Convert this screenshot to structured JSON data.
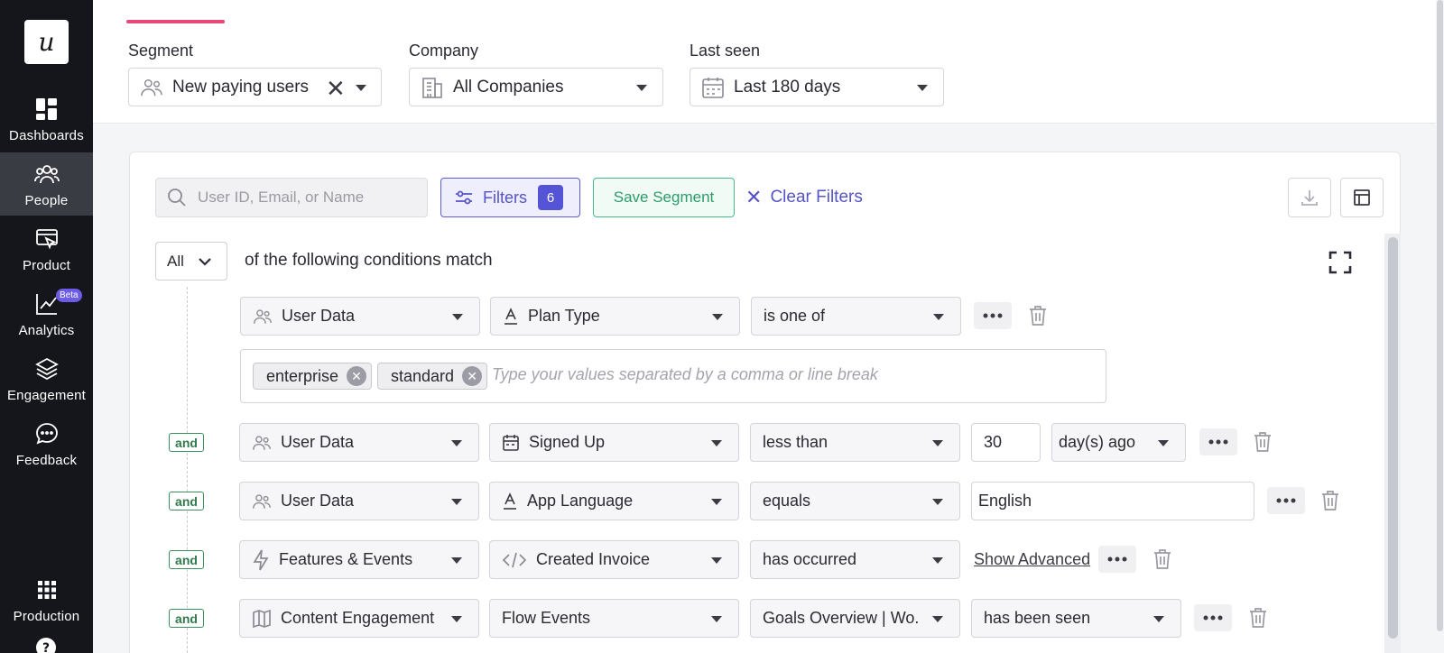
{
  "sidebar": {
    "logo": "u",
    "items": [
      {
        "label": "Dashboards",
        "icon": "dashboard-icon"
      },
      {
        "label": "People",
        "icon": "people-icon"
      },
      {
        "label": "Product",
        "icon": "product-icon"
      },
      {
        "label": "Analytics",
        "icon": "analytics-icon",
        "badge": "Beta"
      },
      {
        "label": "Engagement",
        "icon": "layers-icon"
      },
      {
        "label": "Feedback",
        "icon": "chat-icon"
      },
      {
        "label": "Production",
        "icon": "grid-icon"
      }
    ],
    "help_icon": "help-icon"
  },
  "topbar": {
    "segment": {
      "label": "Segment",
      "value": "New paying users"
    },
    "company": {
      "label": "Company",
      "value": "All Companies"
    },
    "last_seen": {
      "label": "Last seen",
      "value": "Last 180 days"
    }
  },
  "toolbar": {
    "search_placeholder": "User ID, Email, or Name",
    "filters_label": "Filters",
    "filters_count": "6",
    "save_label": "Save Segment",
    "clear_label": "Clear Filters"
  },
  "match": {
    "mode": "All",
    "text": "of the following conditions match"
  },
  "conditions": [
    {
      "connector": "",
      "source": "User Data",
      "field": "Plan Type",
      "operator": "is one of",
      "values": [
        "enterprise",
        "standard"
      ],
      "values_placeholder": "Type your values separated by a comma or line break"
    },
    {
      "connector": "and",
      "source": "User Data",
      "field": "Signed Up",
      "operator": "less than",
      "amount": "30",
      "unit": "day(s) ago"
    },
    {
      "connector": "and",
      "source": "User Data",
      "field": "App Language",
      "operator": "equals",
      "value": "English"
    },
    {
      "connector": "and",
      "source": "Features & Events",
      "field": "Created Invoice",
      "operator": "has occurred",
      "link": "Show Advanced"
    },
    {
      "connector": "and",
      "source": "Content Engagement",
      "field": "Flow Events",
      "operator": "Goals Overview | Wo...",
      "value": "has been seen"
    }
  ],
  "colors": {
    "sidebar_bg": "#15161b",
    "accent_pink": "#e84a78",
    "brand_purple": "#5553c8",
    "save_green": "#2f9a6a",
    "and_green": "#2f7a4c"
  }
}
